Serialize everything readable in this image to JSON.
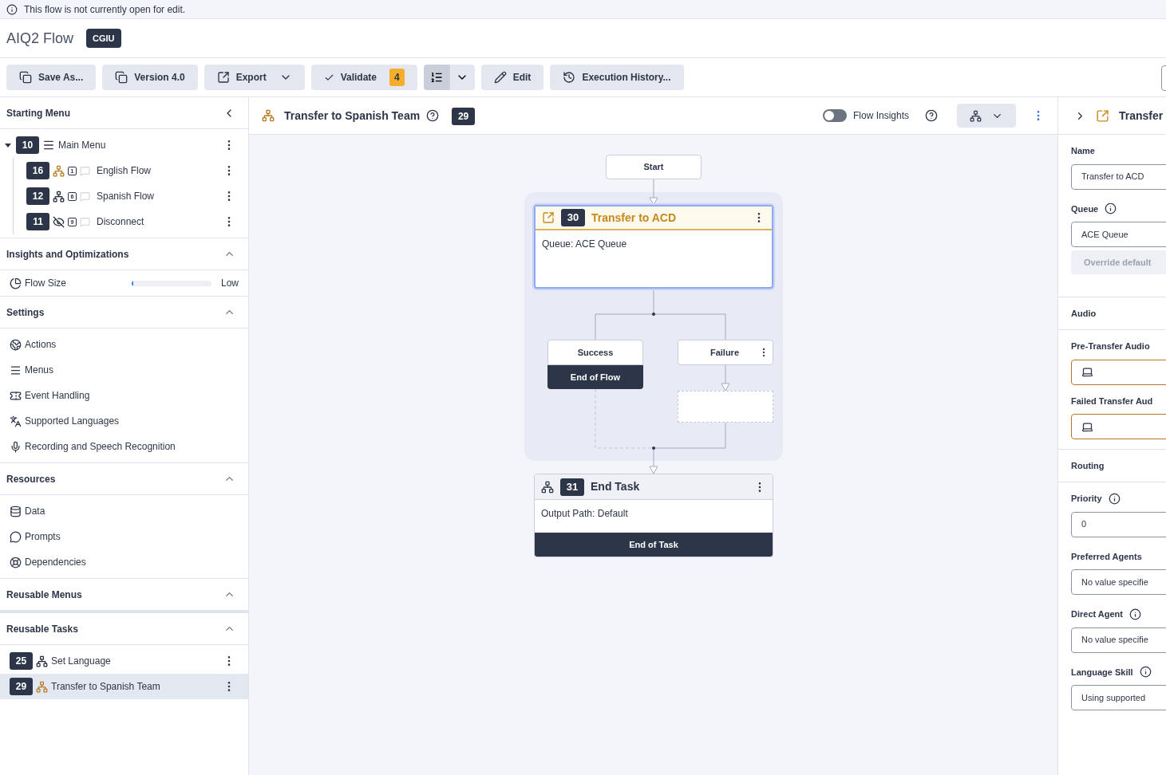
{
  "banner": {
    "text": "This flow is not currently open for edit."
  },
  "header": {
    "title": "AIQ2 Flow",
    "badge": "CGIU"
  },
  "toolbar": [
    {
      "kind": "button",
      "label": "Save As..."
    },
    {
      "kind": "button",
      "label": "Version 4.0"
    },
    {
      "kind": "button",
      "label": "Export",
      "dropdown": true
    },
    {
      "kind": "button",
      "label": "Validate",
      "badge": "4"
    },
    {
      "kind": "split",
      "selected": true
    },
    {
      "kind": "button",
      "label": "Edit"
    },
    {
      "kind": "button",
      "label": "Execution History..."
    }
  ],
  "sidebar": {
    "starting_menu": {
      "title": "Starting Menu",
      "root": {
        "number": "10",
        "label": "Main Menu",
        "expanded": true,
        "children": [
          {
            "number": "16",
            "label": "English Flow",
            "kind": "flow",
            "key": "1",
            "color": "#b7791f"
          },
          {
            "number": "12",
            "label": "Spanish Flow",
            "kind": "flow",
            "key": "6",
            "color": "#1f2937"
          },
          {
            "number": "11",
            "label": "Disconnect",
            "kind": "disconnect",
            "key": "9",
            "color": "#1f2937"
          }
        ]
      }
    },
    "insights": {
      "title": "Insights and Optimizations",
      "expanded": true,
      "flow_size": {
        "label": "Flow Size",
        "level": 0.02,
        "reading": "Low"
      }
    },
    "settings": {
      "title": "Settings",
      "expanded": true,
      "items": [
        "Actions",
        "Menus",
        "Event Handling",
        "Supported Languages",
        "Recording and Speech Recognition"
      ]
    },
    "resources": {
      "title": "Resources",
      "expanded": true,
      "items": [
        "Data",
        "Prompts",
        "Dependencies"
      ]
    },
    "reusable_menus": {
      "title": "Reusable Menus",
      "expanded": true
    },
    "reusable_tasks": {
      "title": "Reusable Tasks",
      "expanded": true,
      "items": [
        {
          "number": "25",
          "label": "Set Language",
          "selected": false,
          "color": "#1f2937"
        },
        {
          "number": "29",
          "label": "Transfer to Spanish Team",
          "selected": true,
          "color": "#b7791f"
        }
      ]
    }
  },
  "canvas": {
    "title": "Transfer to Spanish Team",
    "number": "29",
    "flow_insights": {
      "label": "Flow Insights",
      "on": false
    },
    "start": {
      "label": "Start"
    },
    "transfer": {
      "number": "30",
      "title": "Transfer to ACD",
      "body": "Queue: ACE Queue",
      "selected": true
    },
    "outcomes": [
      {
        "label": "Success",
        "footer": "End of Flow"
      },
      {
        "label": "Failure"
      }
    ],
    "end_task": {
      "number": "31",
      "title": "End Task",
      "body": "Output Path: Default",
      "footer": "End of Task"
    }
  },
  "panel": {
    "title": "Transfer",
    "items": [
      {
        "kind": "field",
        "label": "Name",
        "value": "Transfer to ACD"
      },
      {
        "kind": "field",
        "label": "Queue",
        "info": true,
        "value": "ACE Queue"
      },
      {
        "kind": "button",
        "label": "Override default",
        "disabled": true
      },
      {
        "kind": "section",
        "label": "Audio"
      },
      {
        "kind": "audio",
        "label": "Pre-Transfer Audio"
      },
      {
        "kind": "audio",
        "label": "Failed Transfer Aud"
      },
      {
        "kind": "section",
        "label": "Routing"
      },
      {
        "kind": "field",
        "label": "Priority",
        "info": true,
        "value": "0"
      },
      {
        "kind": "field",
        "label": "Preferred Agents",
        "value": "No value specifie"
      },
      {
        "kind": "field",
        "label": "Direct Agent",
        "info": true,
        "value": "No value specifie"
      },
      {
        "kind": "field",
        "label": "Language Skill",
        "info": true,
        "value": "Using supported"
      }
    ]
  }
}
